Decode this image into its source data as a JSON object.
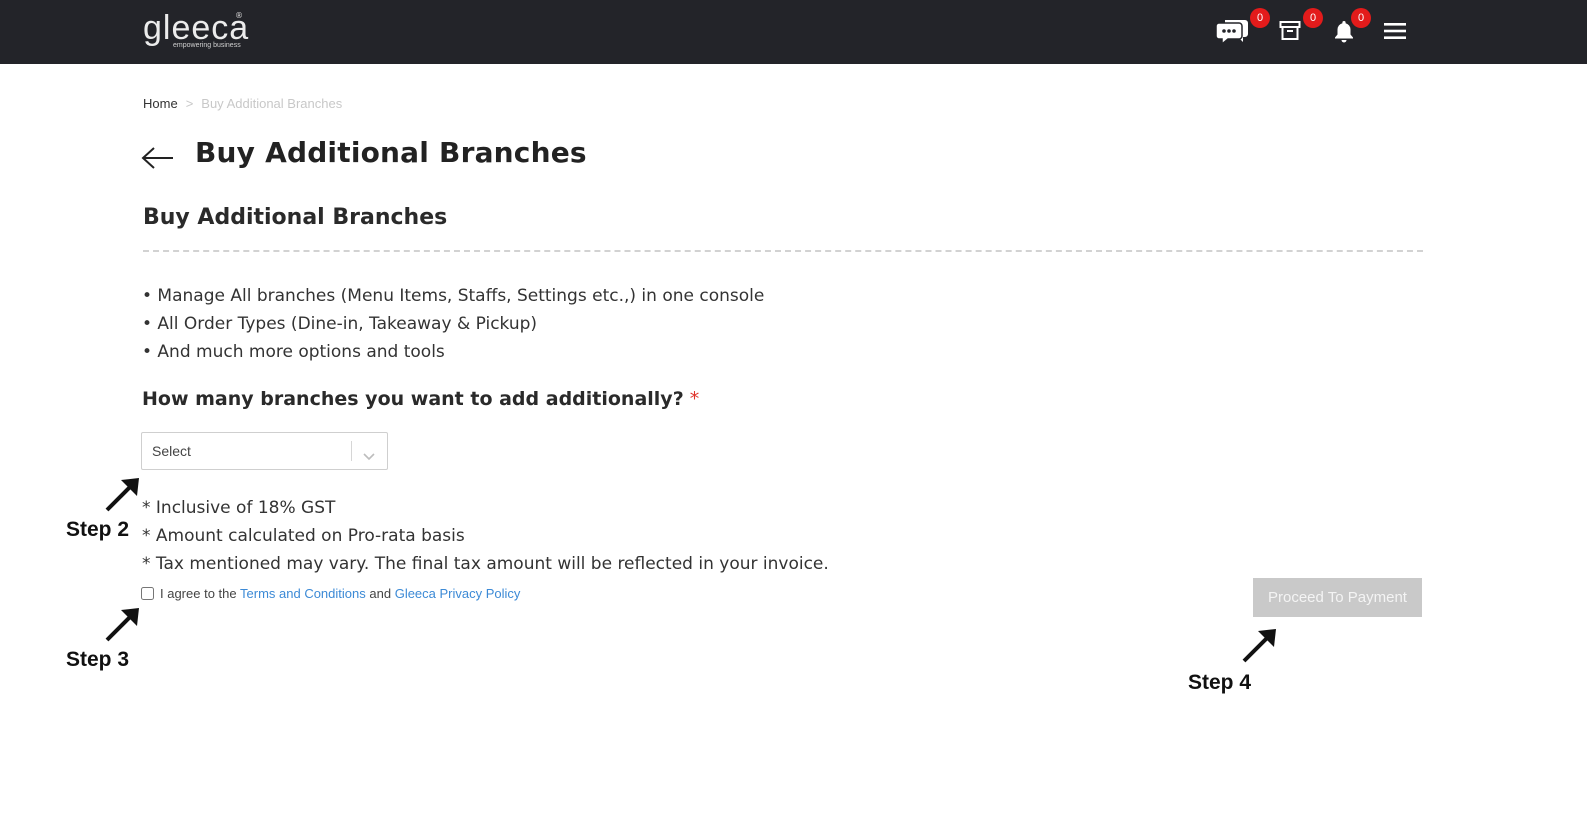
{
  "header": {
    "logo_text": "gleeca",
    "logo_reg": "®",
    "logo_tagline": "empowering business",
    "icons": [
      {
        "name": "chat-icon",
        "count": "0"
      },
      {
        "name": "archive-icon",
        "count": "0"
      },
      {
        "name": "bell-icon",
        "count": "0"
      },
      {
        "name": "hamburger-menu-icon"
      }
    ],
    "badge_color": "#e31b1b",
    "bar_color": "#232429"
  },
  "breadcrumb": {
    "home": "Home",
    "separator": ">",
    "current": "Buy Additional Branches"
  },
  "page": {
    "title": "Buy Additional Branches",
    "section_title": "Buy Additional Branches",
    "features": [
      "• Manage All branches (Menu Items, Staffs, Settings etc.,) in one console",
      "• All Order Types (Dine-in, Takeaway & Pickup)",
      "• And much more options and tools"
    ],
    "question": "How many branches you want to add additionally?",
    "required_mark": "*",
    "select": {
      "value": "Select"
    },
    "notes": [
      "* Inclusive of 18% GST",
      "* Amount calculated on Pro-rata basis",
      "* Tax mentioned may vary. The final tax amount will be reflected in your invoice."
    ],
    "agree": {
      "prefix": "I agree to the",
      "terms_link": "Terms and Conditions",
      "and": "and",
      "privacy_link": "Gleeca Privacy Policy",
      "checked": false
    },
    "proceed_button": "Proceed To Payment",
    "link_color": "#3c8ad6"
  },
  "annotations": {
    "step2": "Step 2",
    "step3": "Step 3",
    "step4": "Step 4"
  }
}
